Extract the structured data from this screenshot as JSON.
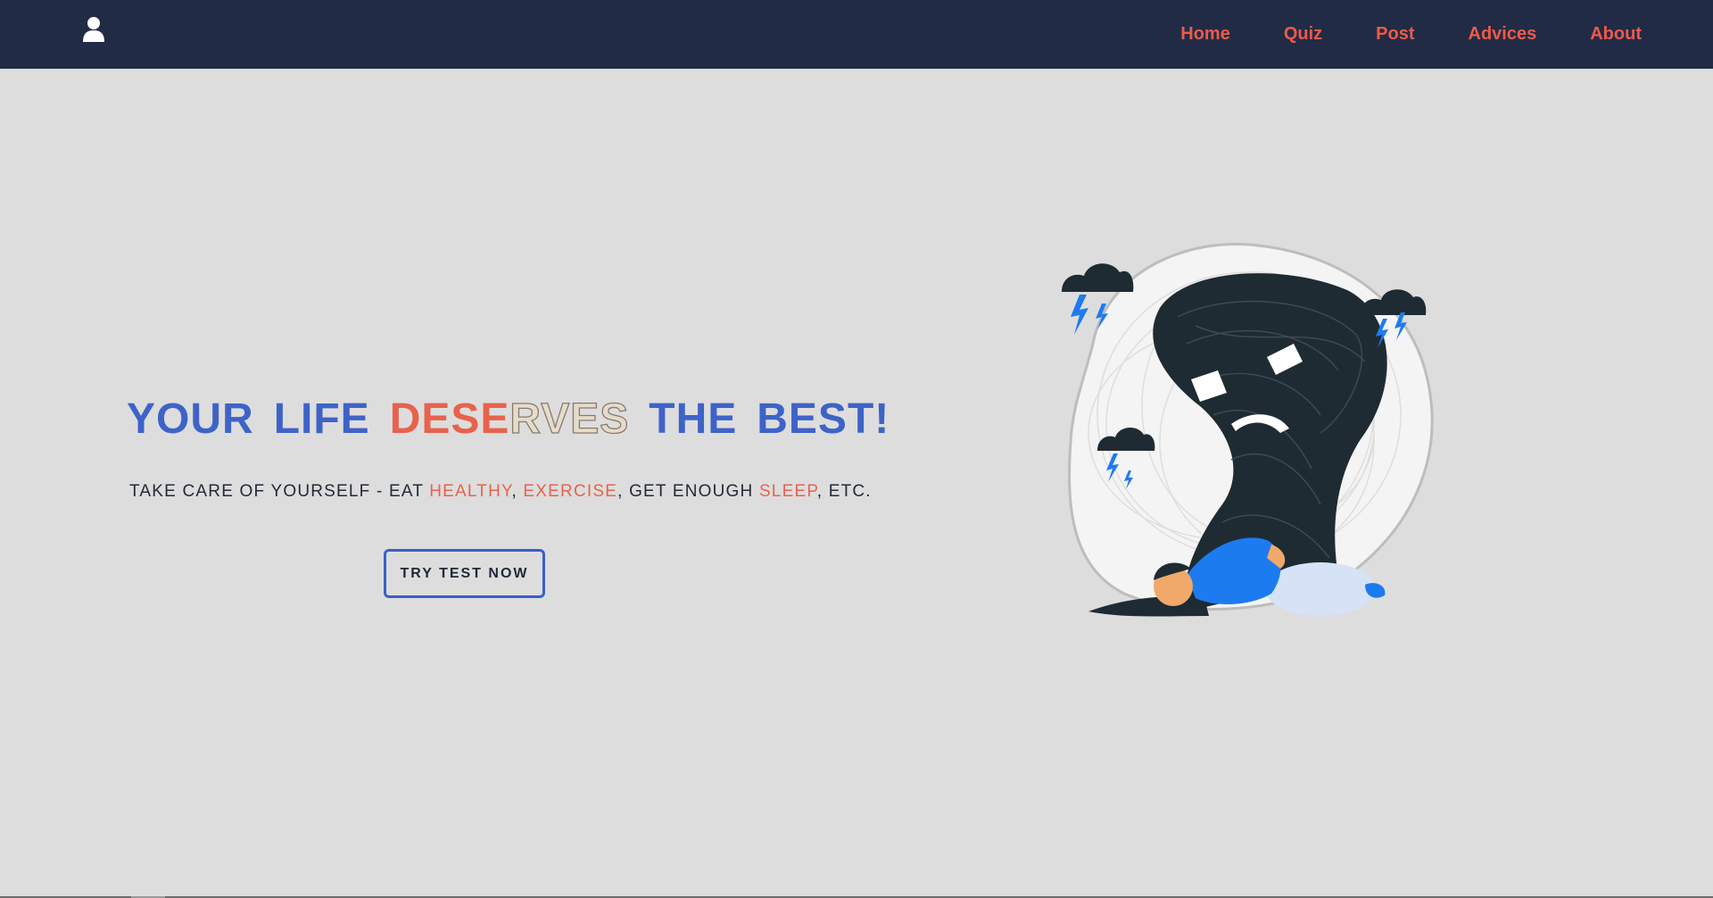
{
  "nav": {
    "links": [
      "Home",
      "Quiz",
      "Post",
      "Advices",
      "About"
    ]
  },
  "hero": {
    "title_words": {
      "your": "YOUR",
      "life": "LIFE",
      "deserves_colored": "DESE",
      "deserves_outline": "RVES",
      "the": "THE",
      "best": "BEST!"
    },
    "subtitle": {
      "part1": "TAKE CARE OF YOURSELF - EAT ",
      "healthy": "HEALTHY",
      "sep1": ", ",
      "exercise": "EXERCISE",
      "part2": ", GET ENOUGH ",
      "sleep": "SLEEP",
      "part3": ", ETC."
    },
    "cta_label": "TRY TEST NOW"
  },
  "colors": {
    "navbar_bg": "#212b45",
    "nav_link": "#ee5a4a",
    "accent_blue": "#3e63c8",
    "accent_red": "#e8624c",
    "page_bg": "#dddddd"
  },
  "icons": {
    "user": "user-icon"
  }
}
